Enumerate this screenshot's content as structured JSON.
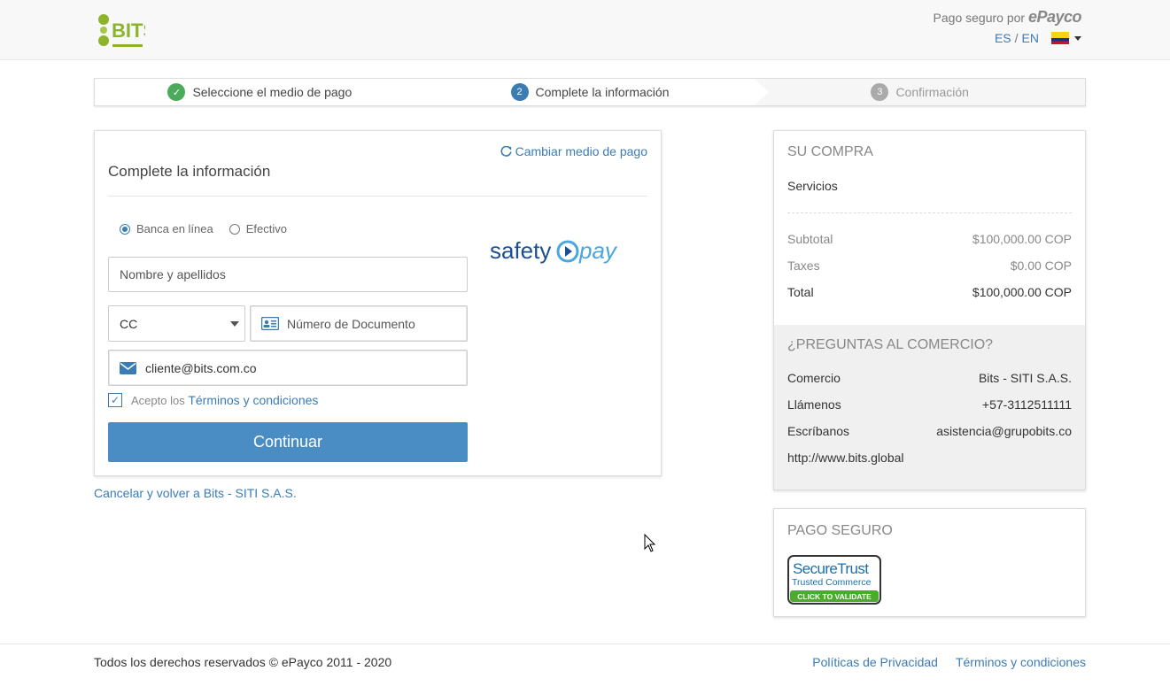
{
  "header": {
    "secure_text": "Pago seguro por",
    "brand": "ePayco",
    "lang_es": "ES",
    "lang_sep": "/",
    "lang_en": "EN",
    "logo_label": "BITS"
  },
  "steps": [
    {
      "label": "Seleccione el medio de pago",
      "badge": "✓",
      "state": "done"
    },
    {
      "label": "Complete la información",
      "badge": "2",
      "state": "current"
    },
    {
      "label": "Confirmación",
      "badge": "3",
      "state": "future"
    }
  ],
  "form": {
    "title": "Complete la información",
    "change_link": "Cambiar medio de pago",
    "radio_online": "Banca en línea",
    "radio_cash": "Efectivo",
    "name_placeholder": "Nombre y apellidos",
    "doc_type": "CC",
    "doc_number_placeholder": "Número de Documento",
    "email_value": "cliente@bits.com.co",
    "terms_prefix": "Acepto los",
    "terms_link": "Términos y condiciones",
    "continue_label": "Continuar",
    "provider_logo_a": "safety",
    "provider_logo_b": "pay"
  },
  "cancel_link": "Cancelar y volver a Bits - SITI S.A.S.",
  "summary": {
    "heading": "SU COMPRA",
    "item": "Servicios",
    "subtotal_label": "Subtotal",
    "subtotal_value": "$100,000.00 COP",
    "taxes_label": "Taxes",
    "taxes_value": "$0.00 COP",
    "total_label": "Total",
    "total_value": "$100,000.00 COP"
  },
  "questions": {
    "heading": "¿PREGUNTAS AL COMERCIO?",
    "merchant_label": "Comercio",
    "merchant_value": "Bits - SITI S.A.S.",
    "call_label": "Llámenos",
    "call_value": "+57-3112511111",
    "write_label": "Escríbanos",
    "write_value": "asistencia@grupobits.co",
    "website": "http://www.bits.global"
  },
  "secure": {
    "heading": "PAGO SEGURO",
    "badge_line1": "SecureTrust",
    "badge_line2": "Trusted Commerce",
    "badge_line3": "CLICK TO VALIDATE"
  },
  "footer": {
    "copyright": "Todos los derechos reservados © ePayco 2011 - 2020",
    "privacy": "Políticas de Privacidad",
    "terms": "Términos y condiciones"
  },
  "colors": {
    "accent": "#3b7cb5",
    "button": "#4a8dc4",
    "done": "#4caa5b",
    "logo_green": "#8cb42a"
  },
  "icons": [
    "check-icon",
    "refresh-icon",
    "id-card-icon",
    "envelope-icon",
    "chevron-down-icon",
    "flag-colombia-icon",
    "checkbox-icon",
    "cursor-icon"
  ]
}
